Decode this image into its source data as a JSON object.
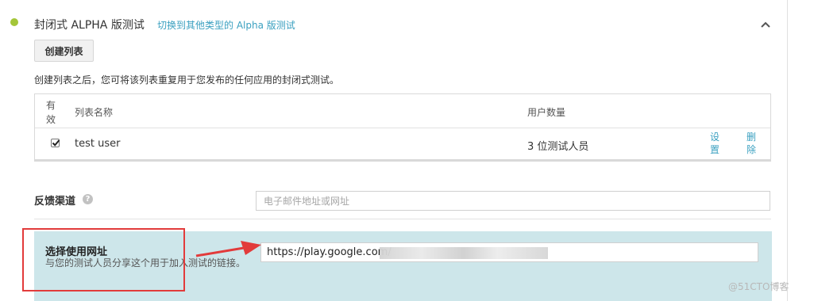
{
  "section": {
    "title": "封闭式 ALPHA 版测试",
    "switch_link": "切换到其他类型的 Alpha 版测试",
    "status_color": "#a4c639",
    "collapse_icon": "chevron-up-icon"
  },
  "create_button": {
    "label": "创建列表"
  },
  "description": "创建列表之后，您可将该列表重复用于您发布的任何应用的封闭式测试。",
  "list_table": {
    "headers": {
      "valid": "有效",
      "name": "列表名称",
      "users": "用户数量"
    },
    "rows": [
      {
        "checked": true,
        "name": "test user",
        "users": "3 位测试人员",
        "settings": "设置",
        "delete": "删除"
      }
    ]
  },
  "feedback": {
    "label": "反馈渠道",
    "help_icon": "question-icon",
    "placeholder": "电子邮件地址或网址",
    "value": ""
  },
  "opt_in": {
    "title": "选择使用网址",
    "description": "与您的测试人员分享这个用于加入测试的链接。",
    "url": "https://play.google.com/",
    "band_color": "#cde6ea"
  },
  "annotation": {
    "box_color": "#e23b3b",
    "arrow_color": "#e23b3b"
  },
  "watermark": "@51CTO博客"
}
